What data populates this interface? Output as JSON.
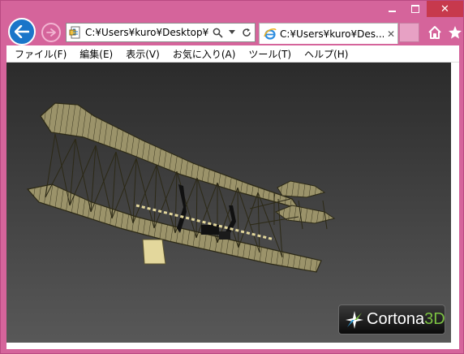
{
  "window": {
    "address": "C:¥Users¥kuro¥Desktop¥M",
    "tab_title": "C:¥Users¥kuro¥Des...",
    "close_glyph": "✕"
  },
  "menu": {
    "items": [
      {
        "label": "ファイル(F)"
      },
      {
        "label": "編集(E)"
      },
      {
        "label": "表示(V)"
      },
      {
        "label": "お気に入り(A)"
      },
      {
        "label": "ツール(T)"
      },
      {
        "label": "ヘルプ(H)"
      }
    ]
  },
  "viewer": {
    "logo_text": "Cortona",
    "logo_accent": "3D"
  },
  "colors": {
    "frame": "#d5649b",
    "close_button": "#c7394d",
    "back_button": "#1a75c9",
    "plane_body": "#9b936a",
    "plane_line": "#3a3620",
    "logo_accent": "#7cc242"
  },
  "icons": {
    "back": "back-arrow-icon",
    "forward": "forward-arrow-icon",
    "page": "page-icon",
    "search": "search-icon",
    "dropdown": "dropdown-icon",
    "refresh": "refresh-icon",
    "ie": "ie-icon",
    "home": "home-icon",
    "favorites": "star-icon"
  }
}
